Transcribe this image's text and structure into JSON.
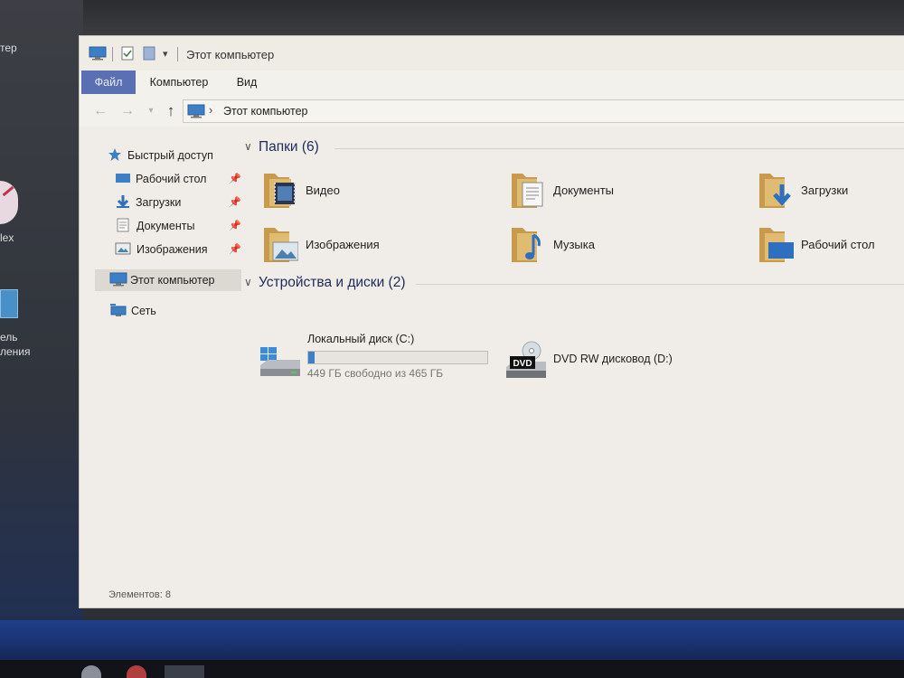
{
  "window": {
    "title": "Этот компьютер"
  },
  "ribbon": {
    "tabs": [
      {
        "label": "Файл",
        "active": true
      },
      {
        "label": "Компьютер"
      },
      {
        "label": "Вид"
      }
    ]
  },
  "address": {
    "path": "Этот компьютер"
  },
  "sidebar": {
    "quick_access": "Быстрый доступ",
    "pinned": [
      {
        "label": "Рабочий стол",
        "icon": "desktop-icon"
      },
      {
        "label": "Загрузки",
        "icon": "download-icon"
      },
      {
        "label": "Документы",
        "icon": "document-icon"
      },
      {
        "label": "Изображения",
        "icon": "picture-icon"
      }
    ],
    "this_pc": "Этот компьютер",
    "network": "Сеть"
  },
  "folders_group": {
    "header": "Папки (6)",
    "items": [
      {
        "label": "Видео",
        "icon": "video-folder-icon"
      },
      {
        "label": "Документы",
        "icon": "documents-folder-icon"
      },
      {
        "label": "Загрузки",
        "icon": "downloads-folder-icon"
      },
      {
        "label": "Изображения",
        "icon": "pictures-folder-icon"
      },
      {
        "label": "Музыка",
        "icon": "music-folder-icon"
      },
      {
        "label": "Рабочий стол",
        "icon": "desktop-folder-icon"
      }
    ]
  },
  "devices_group": {
    "header": "Устройства и диски (2)",
    "drives": [
      {
        "label": "Локальный диск (C:)",
        "free_text": "449 ГБ свободно из 465 ГБ",
        "used_fraction": 0.034,
        "icon": "windows-drive-icon"
      },
      {
        "label": "DVD RW дисковод (D:)",
        "icon": "dvd-drive-icon",
        "badge": "DVD"
      }
    ]
  },
  "status": {
    "items_count": "Элементов: 8"
  },
  "desktop": {
    "labels": [
      "тер",
      "lex",
      "ель",
      "ления"
    ]
  },
  "colors": {
    "file_tab": "#5b6fb3",
    "drive_bar": "#3c7fc6",
    "folder": "#dcb46a",
    "taskbar": "#1a3270"
  }
}
